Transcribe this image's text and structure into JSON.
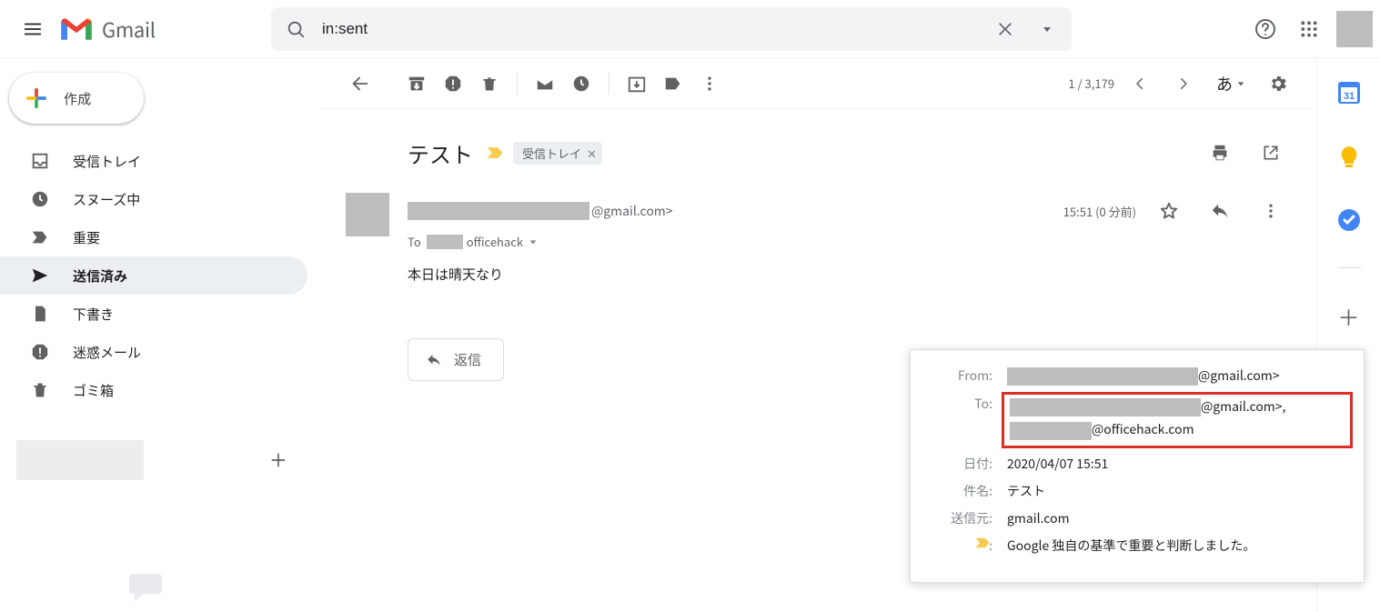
{
  "header": {
    "product": "Gmail",
    "search_value": "in:sent"
  },
  "sidebar": {
    "compose_label": "作成",
    "items": [
      {
        "label": "受信トレイ",
        "icon": "inbox"
      },
      {
        "label": "スヌーズ中",
        "icon": "clock"
      },
      {
        "label": "重要",
        "icon": "important"
      },
      {
        "label": "送信済み",
        "icon": "send",
        "active": true
      },
      {
        "label": "下書き",
        "icon": "draft"
      },
      {
        "label": "迷惑メール",
        "icon": "spam"
      },
      {
        "label": "ゴミ箱",
        "icon": "trash"
      }
    ]
  },
  "toolbar": {
    "counter": "1 / 3,179",
    "lang": "あ"
  },
  "email": {
    "subject": "テスト",
    "label_chip": "受信トレイ",
    "sender_domain": "@gmail.com>",
    "to_prefix": "To",
    "to_display": "officehack",
    "timestamp": "15:51 (0 分前)",
    "body": "本日は晴天なり",
    "reply_label": "返信"
  },
  "details": {
    "from_label": "From:",
    "from_domain": "@gmail.com>",
    "to_label": "To:",
    "to_line1_domain": "@gmail.com>,",
    "to_line2_domain": "@officehack.com",
    "date_label": "日付:",
    "date_value": "2020/04/07 15:51",
    "subject_label": "件名:",
    "subject_value": "テスト",
    "mailedby_label": "送信元:",
    "mailedby_value": "gmail.com",
    "important_text": "Google 独自の基準で重要と判断しました。"
  }
}
